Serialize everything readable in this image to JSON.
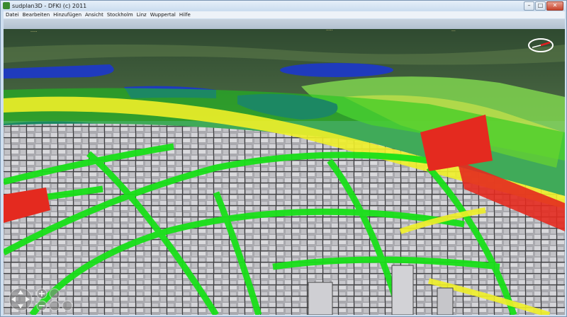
{
  "window": {
    "title": "sudplan3D - DFKI (c) 2011",
    "buttons": {
      "minimize": "–",
      "maximize": "□",
      "close": "✕"
    }
  },
  "menu": {
    "items": [
      "Datei",
      "Bearbeiten",
      "Hinzufügen",
      "Ansicht",
      "Stockholm",
      "Linz",
      "Wuppertal",
      "Hilfe"
    ]
  },
  "scene": {
    "colors": {
      "sky": "#b8c7d8",
      "terrain": "#3f5b3a",
      "water": "#1f3bbd",
      "noise_low": "#19e019",
      "noise_mid": "#f0f028",
      "noise_high": "#e42a1f",
      "buildings": "#b9b9bd"
    },
    "icons": [
      "compass-icon",
      "pan-control-icon",
      "zoom-in-icon",
      "zoom-out-icon",
      "tilt-icon"
    ]
  }
}
